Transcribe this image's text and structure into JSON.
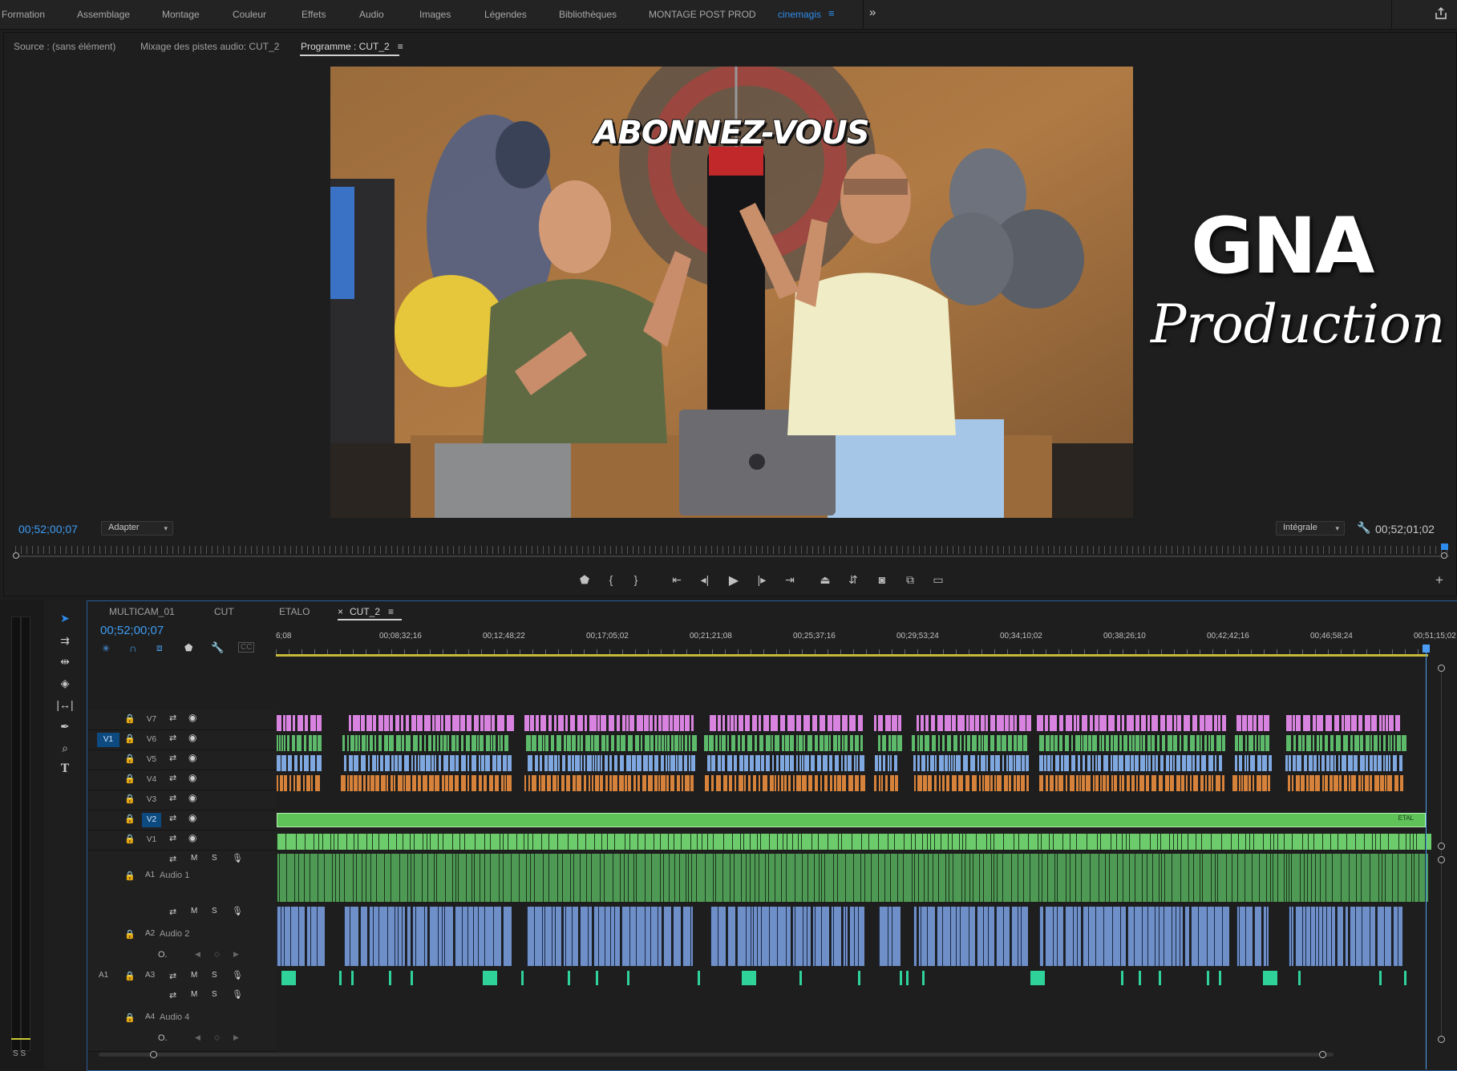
{
  "workspaces": [
    "Formation",
    "Assemblage",
    "Montage",
    "Couleur",
    "Effets",
    "Audio",
    "Images",
    "Légendes",
    "Bibliothèques",
    "MONTAGE POST PROD",
    "cinemagis"
  ],
  "workspace_active": "cinemagis",
  "monitor": {
    "tabs": [
      "Source : (sans élément)",
      "Mixage des pistes audio: CUT_2",
      "Programme : CUT_2"
    ],
    "timecode_current": "00;52;00;07",
    "zoom_value": "Adapter",
    "quality_value": "Intégrale",
    "timecode_duration": "00;52;01;02",
    "overlay_text": "ABONNEZ-VOUS",
    "brand_main": "GNA",
    "brand_sub": "Production"
  },
  "timeline": {
    "tabs": [
      "MULTICAM_01",
      "CUT",
      "ETALO",
      "CUT_2"
    ],
    "active_tab": "CUT_2",
    "timecode": "00;52;00;07",
    "ruler": [
      "6;08",
      "00;08;32;16",
      "00;12;48;22",
      "00;17;05;02",
      "00;21;21;08",
      "00;25;37;16",
      "00;29;53;24",
      "00;34;10;02",
      "00;38;26;10",
      "00;42;42;16",
      "00;46;58;24",
      "00;51;15;02"
    ],
    "video_tracks": [
      "V7",
      "V6",
      "V5",
      "V4",
      "V3",
      "V2",
      "V1"
    ],
    "audio_tracks": [
      {
        "id": "A1",
        "name": "Audio 1"
      },
      {
        "id": "A2",
        "name": "Audio 2"
      },
      {
        "id": "A3",
        "name": ""
      },
      {
        "id": "A4",
        "name": "Audio 4"
      }
    ],
    "source_patch_video": "V1",
    "source_patch_audio": "A1",
    "adjustment_clip_label": "ETAL",
    "mute_label": "M",
    "solo_label": "S",
    "meter_labels": "S S"
  },
  "colors": {
    "accent": "#2d8ceb",
    "v6_clip": "#d983e0",
    "v5_clip": "#5dba6a",
    "v4_clip": "#7fa8e0",
    "v3_clip": "#d7823a",
    "v2_clip": "#5fc258",
    "a1_clip": "#4e9a55",
    "a2_clip": "#6f8fc8",
    "a3_clip": "#2fd39a"
  }
}
